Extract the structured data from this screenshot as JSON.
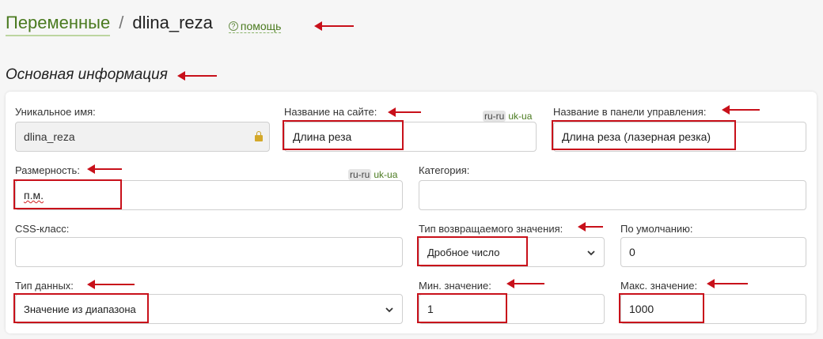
{
  "header": {
    "breadcrumb_parent": "Переменные",
    "separator": "/",
    "current": "dlina_reza",
    "help_label": "помощь",
    "help_icon": "?"
  },
  "section_title": "Основная информация",
  "form": {
    "unique_name": {
      "label": "Уникальное имя:",
      "value": "dlina_reza",
      "icon": "lock-icon"
    },
    "site_name": {
      "label": "Название на сайте:",
      "value": "Длина реза",
      "langs": [
        "ru-ru",
        "uk-ua"
      ]
    },
    "admin_name": {
      "label": "Название в панели управления:",
      "value": "Длина реза (лазерная резка)"
    },
    "dimension": {
      "label": "Размерность:",
      "value": "п.м.",
      "langs": [
        "ru-ru",
        "uk-ua"
      ]
    },
    "category": {
      "label": "Категория:",
      "value": ""
    },
    "css_class": {
      "label": "CSS-класс:",
      "value": ""
    },
    "return_type": {
      "label": "Тип возвращаемого значения:",
      "value": "Дробное число"
    },
    "default_value": {
      "label": "По умолчанию:",
      "value": "0"
    },
    "data_type": {
      "label": "Тип данных:",
      "value": "Значение из диапазона"
    },
    "min_value": {
      "label": "Мин. значение:",
      "value": "1"
    },
    "max_value": {
      "label": "Макс. значение:",
      "value": "1000"
    }
  },
  "colors": {
    "accent_green": "#4a7a1f",
    "annotation_red": "#c8101a"
  }
}
